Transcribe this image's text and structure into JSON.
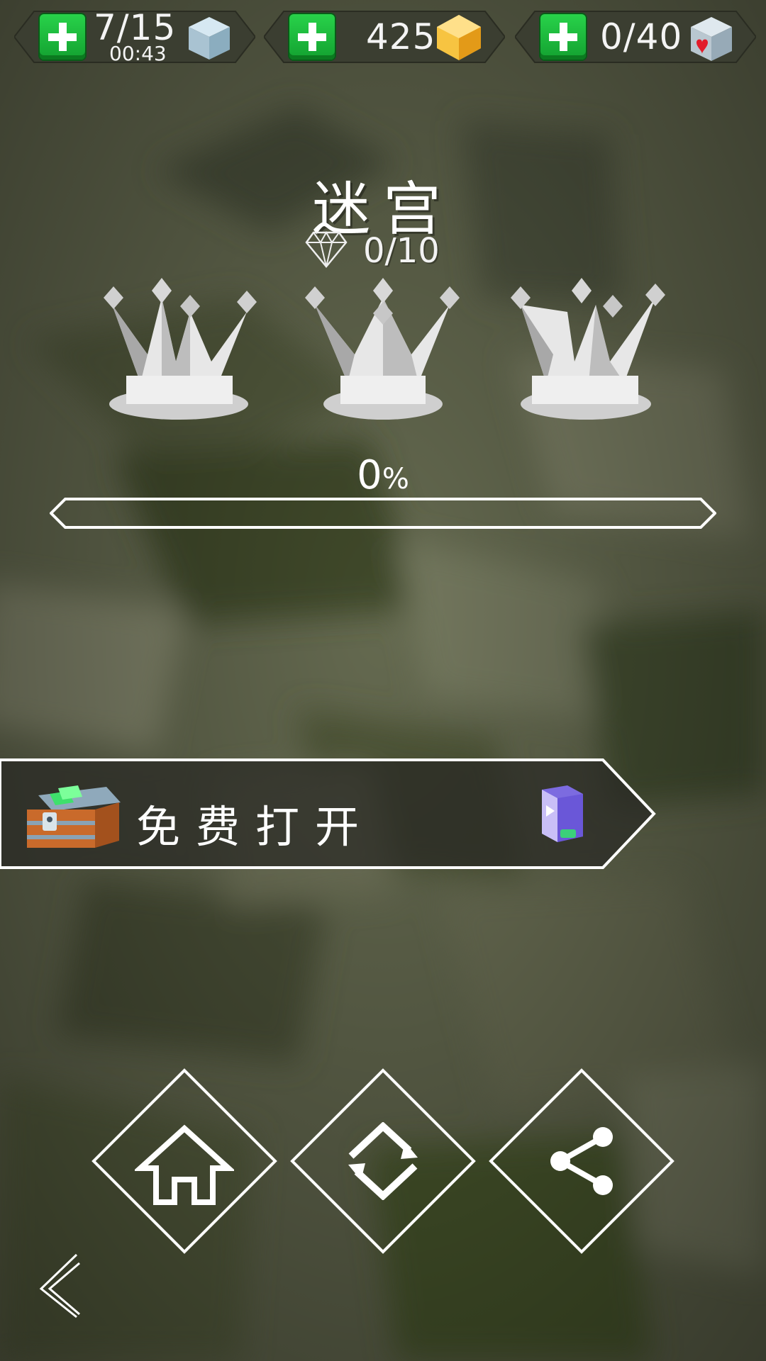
{
  "hud": {
    "energy": {
      "value": "7/15",
      "timer": "00:43",
      "icon": "ice-cube-icon"
    },
    "coins": {
      "value": "425",
      "icon": "gold-gem-icon"
    },
    "hearts": {
      "value": "0/40",
      "icon": "heart-cube-icon"
    },
    "add_icon": "plus-icon"
  },
  "level": {
    "title": "迷宫",
    "gems": "0/10",
    "crowns_earned": 0,
    "crowns_total": 3,
    "progress_text": "0",
    "progress_unit": "%",
    "progress_fraction": 0
  },
  "chest_offer": {
    "label": "免费打开",
    "icon": "treasure-chest-icon",
    "ad_icon": "video-ad-icon"
  },
  "nav": {
    "home_icon": "home-icon",
    "restart_icon": "restart-icon",
    "share_icon": "share-icon",
    "back_icon": "back-arrow-icon"
  },
  "colors": {
    "accent_green": "#1fbf3c",
    "gold": "#f5b32a",
    "plate": "#3c3f33"
  }
}
